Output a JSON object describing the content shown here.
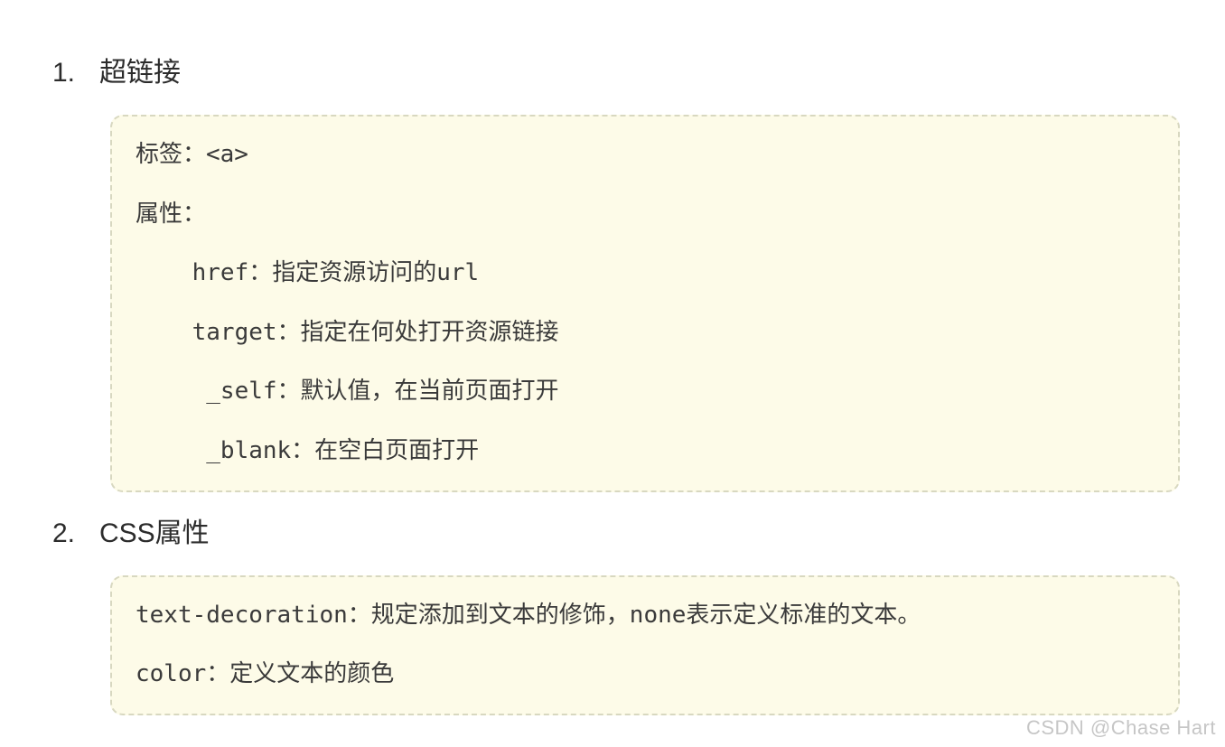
{
  "items": [
    {
      "number": "1.",
      "title": "超链接",
      "lines": [
        "标签：<a>",
        "属性：",
        "    href：指定资源访问的url",
        "    target：指定在何处打开资源链接",
        "     _self：默认值，在当前页面打开",
        "     _blank：在空白页面打开"
      ]
    },
    {
      "number": "2.",
      "title": "CSS属性",
      "lines": [
        "text-decoration：规定添加到文本的修饰，none表示定义标准的文本。",
        "color：定义文本的颜色"
      ]
    }
  ],
  "watermark": "CSDN @Chase Hart"
}
